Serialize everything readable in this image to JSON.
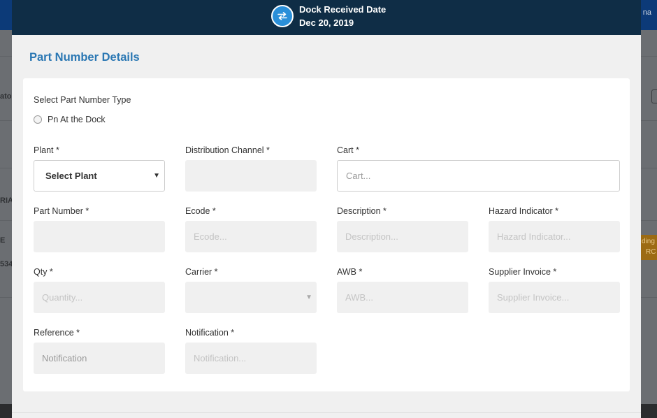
{
  "background": {
    "user_fragment": "na",
    "left_text_1": "atoc",
    "left_text_2": "RIAL",
    "left_text_3": "E",
    "left_text_4": "534",
    "badge_text_1": "ding",
    "badge_text_2": "RC"
  },
  "modal": {
    "header": {
      "title": "Dock Received Date",
      "date": "Dec 20, 2019",
      "icon": "swap-arrows-icon"
    },
    "section_title": "Part Number Details",
    "part_type": {
      "label": "Select Part Number Type",
      "option": "Pn At the Dock",
      "selected": false
    },
    "fields": {
      "plant": {
        "label": "Plant *",
        "value": "Select Plant"
      },
      "distribution_channel": {
        "label": "Distribution Channel *",
        "value": ""
      },
      "cart": {
        "label": "Cart *",
        "placeholder": "Cart..."
      },
      "part_number": {
        "label": "Part Number *",
        "value": ""
      },
      "ecode": {
        "label": "Ecode *",
        "placeholder": "Ecode..."
      },
      "description": {
        "label": "Description *",
        "placeholder": "Description..."
      },
      "hazard_indicator": {
        "label": "Hazard Indicator *",
        "placeholder": "Hazard Indicator..."
      },
      "qty": {
        "label": "Qty *",
        "placeholder": "Quantity..."
      },
      "carrier": {
        "label": "Carrier *",
        "value": ""
      },
      "awb": {
        "label": "AWB *",
        "placeholder": "AWB..."
      },
      "supplier_invoice": {
        "label": "Supplier Invoice *",
        "placeholder": "Supplier Invoice..."
      },
      "reference": {
        "label": "Reference *",
        "value": "Notification"
      },
      "notification": {
        "label": "Notification *",
        "placeholder": "Notification..."
      }
    }
  },
  "colors": {
    "header_bg": "#0f2d46",
    "accent": "#2a8fd9",
    "title": "#2a77b3",
    "disabled_input": "#f0f0f0"
  }
}
